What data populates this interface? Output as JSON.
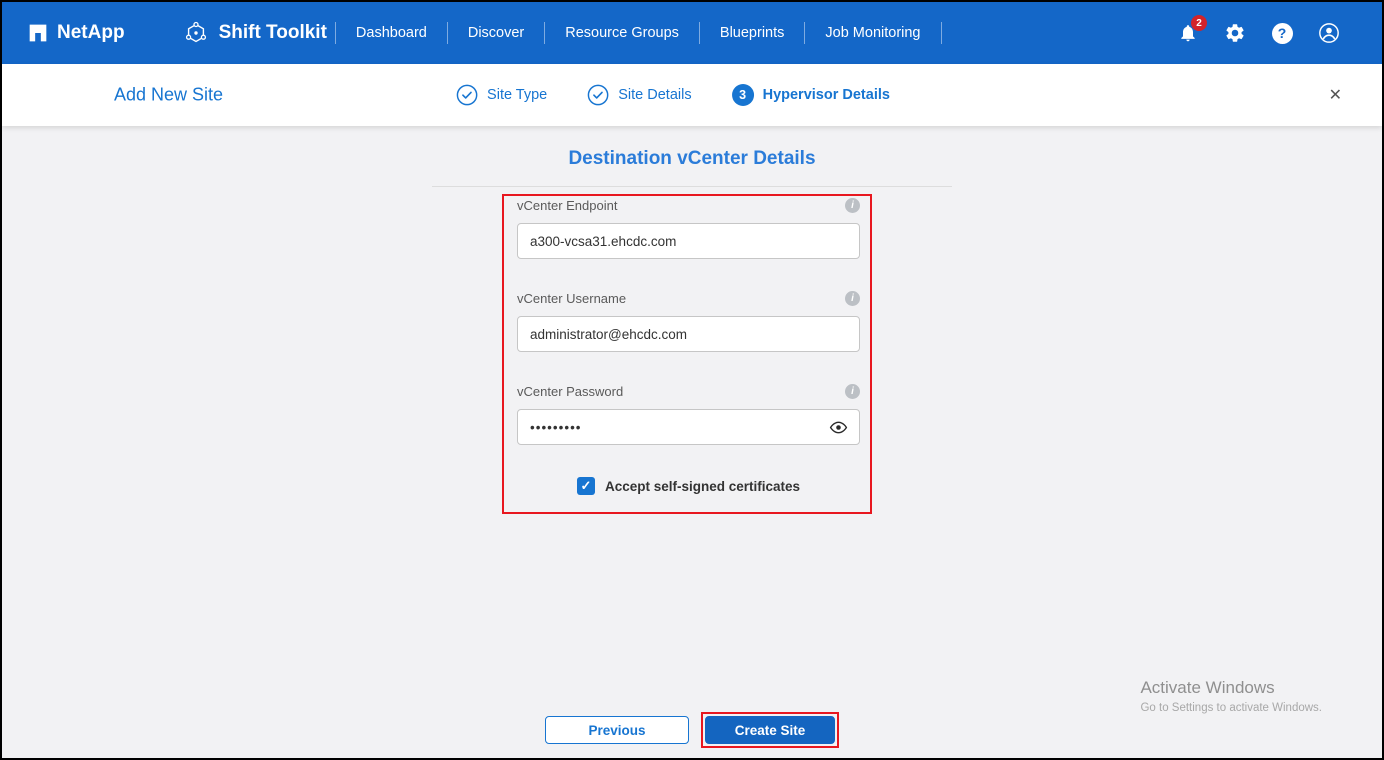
{
  "topnav": {
    "brand": "NetApp",
    "app_title": "Shift Toolkit",
    "items": [
      {
        "label": "Dashboard"
      },
      {
        "label": "Discover"
      },
      {
        "label": "Resource Groups"
      },
      {
        "label": "Blueprints"
      },
      {
        "label": "Job Monitoring"
      }
    ],
    "notification_count": "2",
    "help_glyph": "?"
  },
  "wizard": {
    "title": "Add New Site",
    "steps": [
      {
        "label": "Site Type",
        "state": "complete"
      },
      {
        "label": "Site Details",
        "state": "complete"
      },
      {
        "label": "Hypervisor Details",
        "state": "active",
        "number": "3"
      }
    ],
    "close_glyph": "✕"
  },
  "form": {
    "title": "Destination vCenter Details",
    "fields": [
      {
        "label": "vCenter Endpoint",
        "value": "a300-vcsa31.ehcdc.com",
        "info_glyph": "i"
      },
      {
        "label": "vCenter Username",
        "value": "administrator@ehcdc.com",
        "info_glyph": "i"
      },
      {
        "label": "vCenter Password",
        "value": "•••••••••",
        "info_glyph": "i"
      }
    ],
    "checkbox_label": "Accept self-signed certificates",
    "checkbox_checked": true
  },
  "footer": {
    "previous_label": "Previous",
    "create_label": "Create Site"
  },
  "watermark": {
    "line1": "Activate Windows",
    "line2": "Go to Settings to activate Windows."
  },
  "colors": {
    "topbar_blue": "#1467c8",
    "accent_blue": "#1775d1",
    "primary_button_blue": "#1465c0",
    "annotation_red": "#e8171f",
    "notification_red": "#d2232a",
    "content_background": "#f2f2f4"
  }
}
